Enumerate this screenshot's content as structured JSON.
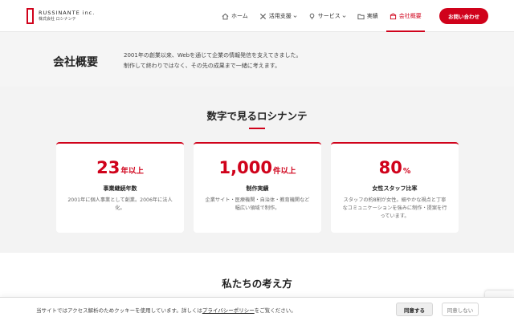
{
  "brand": {
    "name": "RUSSINANTE inc.",
    "sub": "株式会社 ロシナンテ",
    "accent_color": "#d0021b"
  },
  "nav": {
    "items": [
      {
        "label": "ホーム",
        "icon": "home-icon"
      },
      {
        "label": "活用支援",
        "icon": "tools-icon",
        "dropdown": true
      },
      {
        "label": "サービス",
        "icon": "bulb-icon",
        "dropdown": true
      },
      {
        "label": "実績",
        "icon": "folder-icon"
      },
      {
        "label": "会社概要",
        "icon": "building-icon",
        "active": true
      }
    ],
    "contact_label": "お問い合わせ"
  },
  "intro": {
    "title": "会社概要",
    "desc_line1": "2001年の創業以来、Webを通じて企業の情報発信を支えてきました。",
    "desc_line2": "制作して終わりではなく、その先の成果まで一緒に考えます。"
  },
  "numbers": {
    "title": "数字で見るロシナンテ",
    "cards": [
      {
        "value": "23",
        "unit": "年以上",
        "label": "事業継続年数",
        "desc": "2001年に個人事業として創業。2006年に法人化。"
      },
      {
        "value": "1,000",
        "unit": "件以上",
        "label": "制作実績",
        "desc": "企業サイト・医療機関・自治体・教育機関など幅広い領域で制作。"
      },
      {
        "value": "80",
        "unit": "%",
        "label": "女性スタッフ比率",
        "desc": "スタッフの約8割が女性。細やかな視点と丁寧なコミュニケーションを強みに制作・提案を行っています。"
      }
    ]
  },
  "think": {
    "title": "私たちの考え方"
  },
  "cookie": {
    "text_before": "当サイトではアクセス解析のためクッキーを使用しています。詳しくは",
    "link": "プライバシーポリシー",
    "text_after": "をご覧ください。",
    "agree_label": "同意する",
    "decline_label": "同意しない"
  }
}
